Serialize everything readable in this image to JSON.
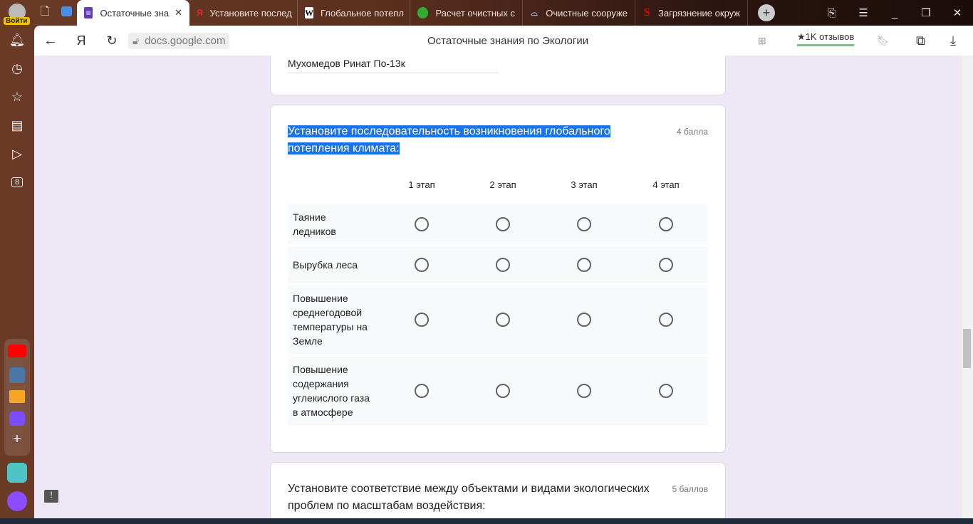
{
  "browser": {
    "login_label": "Войти",
    "tabs": [
      {
        "title": "Остаточные зна",
        "icon": "forms-icon",
        "active": true
      },
      {
        "title": "Установите послед",
        "icon": "yandex-icon"
      },
      {
        "title": "Глобальное потепл",
        "icon": "wikipedia-icon"
      },
      {
        "title": "Расчет очистных с",
        "icon": "leaf-icon"
      },
      {
        "title": "Очистные сооруже",
        "icon": "dome-icon"
      },
      {
        "title": "Загрязнение окруж",
        "icon": "s-icon"
      }
    ],
    "url": "docs.google.com",
    "page_title": "Остаточные знания по Экологии",
    "reviews": "★1K отзывов",
    "yandex_logo": "Я",
    "counter_badge": "8"
  },
  "form": {
    "name_value": "Мухомедов Ринат По-13к",
    "q1": {
      "title": "Установите последовательность возникновения глобального потепления климата:",
      "points": "4 балла",
      "columns": [
        "1 этап",
        "2 этап",
        "3 этап",
        "4 этап"
      ],
      "rows": [
        "Таяние ледников",
        "Вырубка леса",
        "Повышение среднегодовой температуры на Земле",
        "Повышение содержания углекислого газа в атмосфере"
      ]
    },
    "q2": {
      "title": "Установите соответствие между объектами и видами экологических проблем по масштабам воздействия:",
      "points": "5 баллов"
    }
  },
  "colors": {
    "accent": "#673ab7",
    "selection": "#1a73e8",
    "page_bg": "#ede7f6"
  }
}
